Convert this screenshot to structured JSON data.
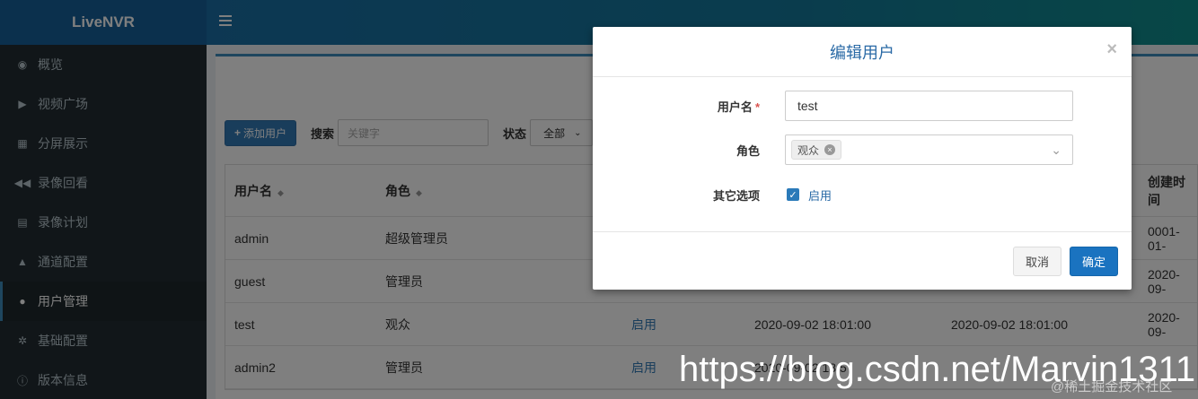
{
  "app": {
    "title": "LiveNVR"
  },
  "sidebar": {
    "items": [
      {
        "label": "概览",
        "icon": "dashboard-icon"
      },
      {
        "label": "视频广场",
        "icon": "play-icon"
      },
      {
        "label": "分屏展示",
        "icon": "grid-icon"
      },
      {
        "label": "录像回看",
        "icon": "backward-icon"
      },
      {
        "label": "录像计划",
        "icon": "calendar-icon"
      },
      {
        "label": "通道配置",
        "icon": "road-icon"
      },
      {
        "label": "用户管理",
        "icon": "users-icon",
        "active": true
      },
      {
        "label": "基础配置",
        "icon": "cogs-icon"
      },
      {
        "label": "版本信息",
        "icon": "info-icon"
      }
    ]
  },
  "toolbar": {
    "add_label": "添加用户",
    "search_label": "搜索",
    "search_placeholder": "关键字",
    "status_label": "状态",
    "status_value": "全部"
  },
  "table": {
    "headers": {
      "username": "用户名",
      "role": "角色",
      "created": "创建时间"
    },
    "rows": [
      {
        "username": "admin",
        "role": "超级管理员",
        "status": "",
        "time1": "",
        "time2": "",
        "created": "0001-01-"
      },
      {
        "username": "guest",
        "role": "管理员",
        "status": "",
        "time1": "",
        "time2": "",
        "created": "2020-09-"
      },
      {
        "username": "test",
        "role": "观众",
        "status": "启用",
        "time1": "2020-09-02 18:01:00",
        "time2": "2020-09-02 18:01:00",
        "created": "2020-09-"
      },
      {
        "username": "admin2",
        "role": "管理员",
        "status": "启用",
        "time1": "2020-09-02 18:5",
        "time2": "",
        "created": ""
      }
    ]
  },
  "modal": {
    "title": "编辑用户",
    "close": "×",
    "fields": {
      "username_label": "用户名",
      "username_required": "*",
      "username_value": "test",
      "role_label": "角色",
      "role_tag": "观众",
      "options_label": "其它选项",
      "enabled_label": "启用",
      "enabled_checked": true
    },
    "cancel_label": "取消",
    "ok_label": "确定"
  },
  "watermark": {
    "text": "https://blog.csdn.net/Marvin1311",
    "sub": "@稀土掘金技术社区"
  }
}
